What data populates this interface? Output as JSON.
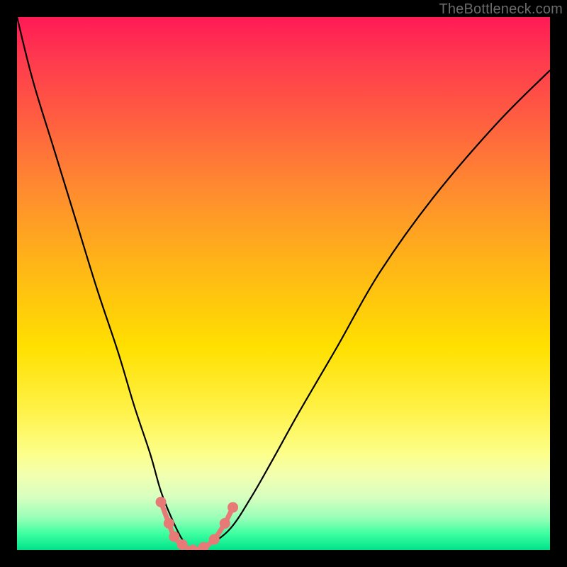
{
  "watermark": "TheBottleneck.com",
  "chart_data": {
    "type": "line",
    "title": "",
    "xlabel": "",
    "ylabel": "",
    "xlim": [
      0,
      100
    ],
    "ylim": [
      0,
      100
    ],
    "grid": false,
    "legend": false,
    "series": [
      {
        "name": "bottleneck-curve",
        "x": [
          0,
          3,
          7,
          11,
          15,
          19,
          22,
          25,
          27,
          29,
          31,
          33,
          36,
          40,
          44,
          48,
          53,
          60,
          68,
          78,
          90,
          100
        ],
        "values": [
          100,
          88,
          75,
          62,
          49,
          37,
          27,
          18,
          11,
          6,
          2,
          0,
          1,
          4,
          10,
          17,
          26,
          38,
          52,
          66,
          80,
          90
        ]
      }
    ],
    "markers": [
      {
        "x": 27,
        "y": 9
      },
      {
        "x": 28.5,
        "y": 5
      },
      {
        "x": 29.5,
        "y": 2.5
      },
      {
        "x": 31,
        "y": 1
      },
      {
        "x": 33,
        "y": 0
      },
      {
        "x": 35,
        "y": 0.5
      },
      {
        "x": 37,
        "y": 2
      },
      {
        "x": 39,
        "y": 5
      },
      {
        "x": 40.5,
        "y": 8
      }
    ],
    "gradient_stops": [
      {
        "pos": 0,
        "color": "#ff1a55"
      },
      {
        "pos": 18,
        "color": "#ff5a42"
      },
      {
        "pos": 46,
        "color": "#ffb418"
      },
      {
        "pos": 74,
        "color": "#fff24a"
      },
      {
        "pos": 90,
        "color": "#d8ffc0"
      },
      {
        "pos": 100,
        "color": "#00e28a"
      }
    ]
  }
}
